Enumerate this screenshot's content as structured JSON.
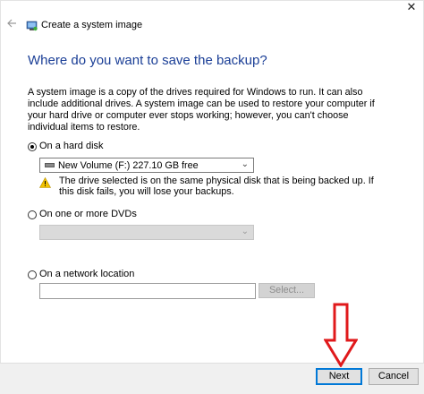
{
  "window": {
    "title": "Create a system image",
    "back_icon": "back-arrow-icon",
    "close_icon": "close-icon"
  },
  "heading": "Where do you want to save the backup?",
  "description": "A system image is a copy of the drives required for Windows to run. It can also include additional drives. A system image can be used to restore your computer if your hard drive or computer ever stops working; however, you can't choose individual items to restore.",
  "options": {
    "hard_disk": {
      "label": "On a hard disk",
      "selected": true,
      "value": "New Volume (F:)  227.10 GB free",
      "warning": "The drive selected is on the same physical disk that is being backed up. If this disk fails, you will lose your backups."
    },
    "dvd": {
      "label": "On one or more DVDs",
      "selected": false,
      "value": ""
    },
    "network": {
      "label": "On a network location",
      "selected": false,
      "value": "",
      "select_label": "Select..."
    }
  },
  "footer": {
    "next_label": "Next",
    "cancel_label": "Cancel"
  },
  "colors": {
    "heading": "#1a3e96",
    "accent": "#0078d7",
    "annotation_arrow": "#e0191b",
    "warning": "#f2c200"
  }
}
